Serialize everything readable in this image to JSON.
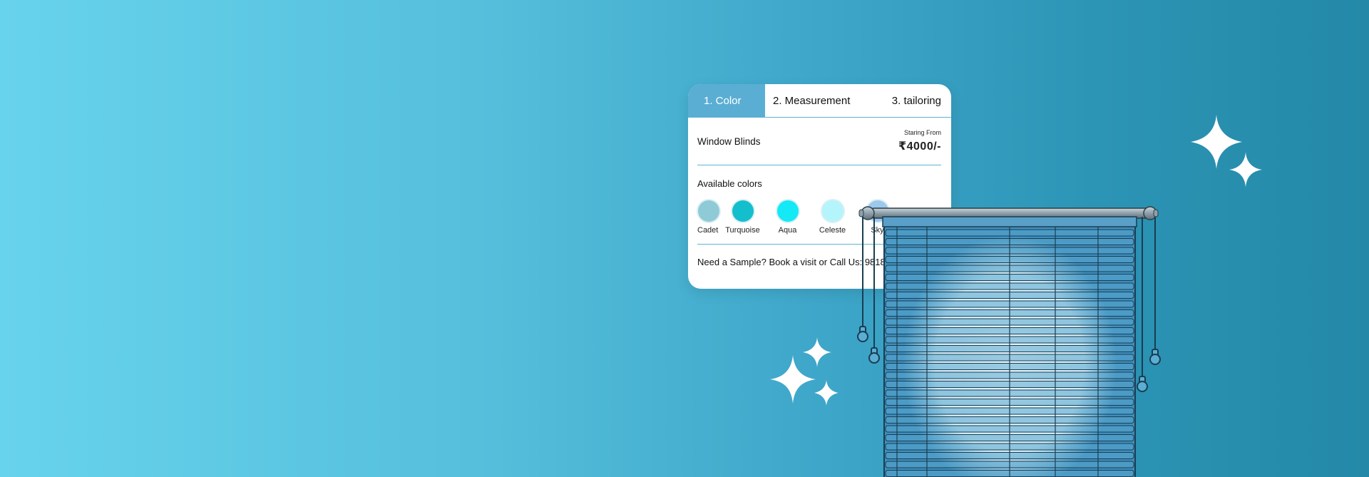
{
  "tabs": [
    {
      "label": "1. Color"
    },
    {
      "label": "2. Measurement"
    },
    {
      "label": "3. tailoring"
    }
  ],
  "product": {
    "name": "Window Blinds",
    "price_caption": "Staring From",
    "price": "₹4000/-"
  },
  "colors": {
    "title": "Available colors",
    "items": [
      {
        "label": "Cadet",
        "hex": "#8ecbd6"
      },
      {
        "label": "Turquoise",
        "hex": "#13bfcc"
      },
      {
        "label": "Aqua",
        "hex": "#14e9f6"
      },
      {
        "label": "Celeste",
        "hex": "#b3f5fb"
      },
      {
        "label": "Sky",
        "hex": "#9cc8ec"
      }
    ]
  },
  "sample": {
    "text": "Need a Sample? Book a visit or Call Us: 9818"
  },
  "theme": {
    "accent": "#5aaed4",
    "background_start": "#68d3ec",
    "background_end": "#2489a8"
  }
}
